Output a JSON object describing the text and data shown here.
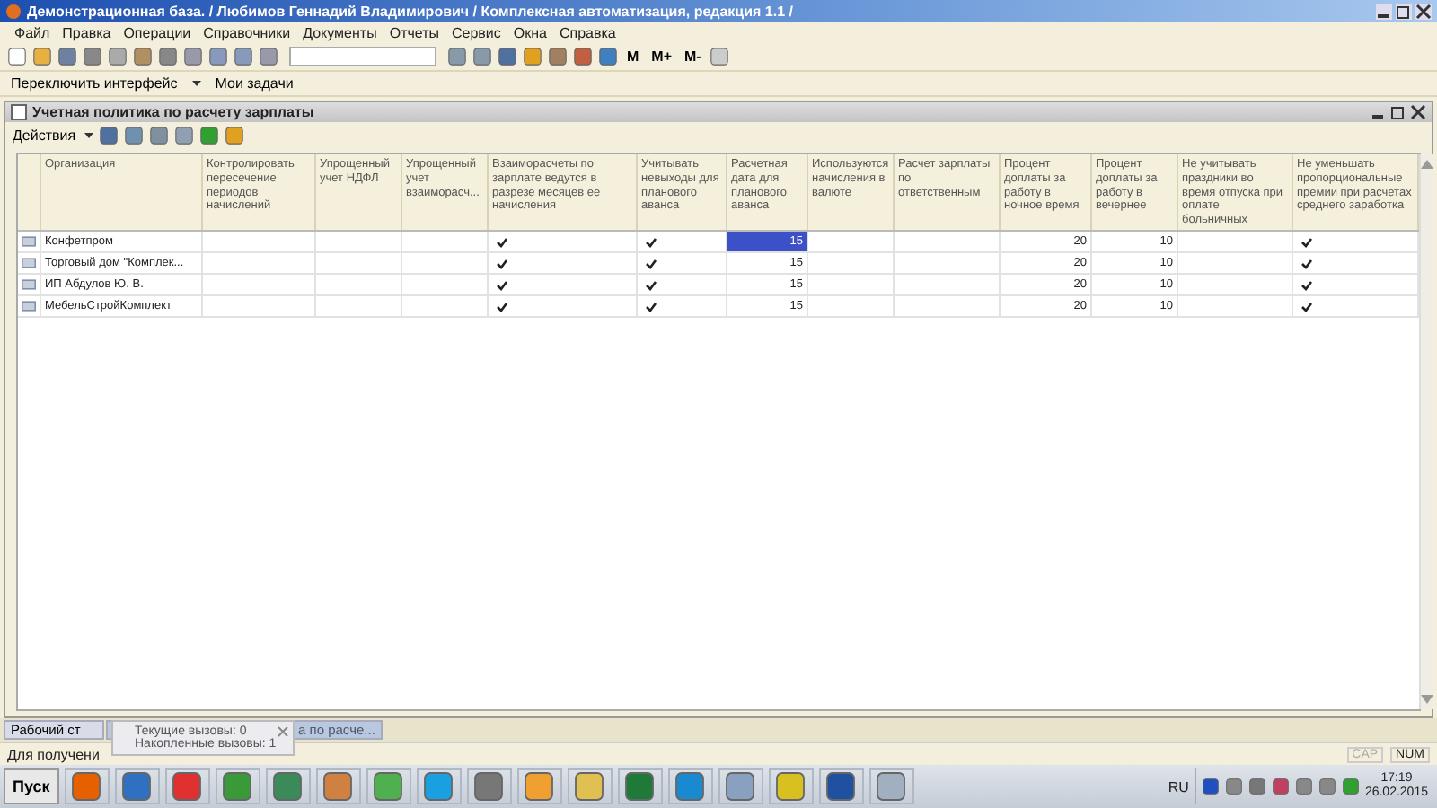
{
  "window": {
    "title": "Демонстрационная база. / Любимов Геннадий Владимирович / Комплексная автоматизация, редакция 1.1 /"
  },
  "menu": [
    "Файл",
    "Правка",
    "Операции",
    "Справочники",
    "Документы",
    "Отчеты",
    "Сервис",
    "Окна",
    "Справка"
  ],
  "toolbar": {
    "memory_buttons": [
      "M",
      "M+",
      "M-"
    ]
  },
  "panel_bar": {
    "switch_interface": "Переключить интерфейс",
    "my_tasks": "Мои задачи"
  },
  "document": {
    "title": "Учетная политика по расчету зарплаты",
    "actions": "Действия",
    "table": {
      "columns": [
        {
          "label": "Организация",
          "kind": "text"
        },
        {
          "label": "Контролировать пересечение периодов начислений",
          "kind": "check"
        },
        {
          "label": "Упрощенный учет НДФЛ",
          "kind": "check"
        },
        {
          "label": "Упрощенный учет взаиморасч...",
          "kind": "check"
        },
        {
          "label": "Взаиморасчеты по зарплате ведутся в разрезе месяцев ее начисления",
          "kind": "check"
        },
        {
          "label": "Учитывать невыходы для планового аванса",
          "kind": "check"
        },
        {
          "label": "Расчетная дата для планового аванса",
          "kind": "number"
        },
        {
          "label": "Используются начисления в валюте",
          "kind": "check"
        },
        {
          "label": "Расчет зарплаты по ответственным",
          "kind": "check"
        },
        {
          "label": "Процент доплаты за работу в ночное время",
          "kind": "number"
        },
        {
          "label": "Процент доплаты за работу в вечернее",
          "kind": "number"
        },
        {
          "label": "Не учитывать праздники во время отпуска при оплате больничных",
          "kind": "check"
        },
        {
          "label": "Не уменьшать пропорциональные премии при расчетах среднего заработка",
          "kind": "check"
        }
      ],
      "rows": [
        {
          "cells": [
            {
              "value": "Конфетпром",
              "selected": false
            },
            {
              "checked": false,
              "selected": false
            },
            {
              "checked": false,
              "selected": false
            },
            {
              "checked": false,
              "selected": false
            },
            {
              "checked": true,
              "selected": false
            },
            {
              "checked": true,
              "selected": false
            },
            {
              "value": "15",
              "selected": true
            },
            {
              "checked": false,
              "selected": false
            },
            {
              "checked": false,
              "selected": false
            },
            {
              "value": "20",
              "selected": false
            },
            {
              "value": "10",
              "selected": false
            },
            {
              "checked": false,
              "selected": false
            },
            {
              "checked": true,
              "selected": false
            }
          ]
        },
        {
          "cells": [
            {
              "value": "Торговый дом \"Комплек...",
              "selected": false
            },
            {
              "checked": false,
              "selected": false
            },
            {
              "checked": false,
              "selected": false
            },
            {
              "checked": false,
              "selected": false
            },
            {
              "checked": true,
              "selected": false
            },
            {
              "checked": true,
              "selected": false
            },
            {
              "value": "15",
              "selected": false
            },
            {
              "checked": false,
              "selected": false
            },
            {
              "checked": false,
              "selected": false
            },
            {
              "value": "20",
              "selected": false
            },
            {
              "value": "10",
              "selected": false
            },
            {
              "checked": false,
              "selected": false
            },
            {
              "checked": true,
              "selected": false
            }
          ]
        },
        {
          "cells": [
            {
              "value": "ИП Абдулов Ю. В.",
              "selected": false
            },
            {
              "checked": false,
              "selected": false
            },
            {
              "checked": false,
              "selected": false
            },
            {
              "checked": false,
              "selected": false
            },
            {
              "checked": true,
              "selected": false
            },
            {
              "checked": true,
              "selected": false
            },
            {
              "value": "15",
              "selected": false
            },
            {
              "checked": false,
              "selected": false
            },
            {
              "checked": false,
              "selected": false
            },
            {
              "value": "20",
              "selected": false
            },
            {
              "value": "10",
              "selected": false
            },
            {
              "checked": false,
              "selected": false
            },
            {
              "checked": true,
              "selected": false
            }
          ]
        },
        {
          "cells": [
            {
              "value": "МебельСтройКомплект",
              "selected": false
            },
            {
              "checked": false,
              "selected": false
            },
            {
              "checked": false,
              "selected": false
            },
            {
              "checked": false,
              "selected": false
            },
            {
              "checked": true,
              "selected": false
            },
            {
              "checked": true,
              "selected": false
            },
            {
              "value": "15",
              "selected": false
            },
            {
              "checked": false,
              "selected": false
            },
            {
              "checked": false,
              "selected": false
            },
            {
              "value": "20",
              "selected": false
            },
            {
              "value": "10",
              "selected": false
            },
            {
              "checked": false,
              "selected": false
            },
            {
              "checked": true,
              "selected": false
            }
          ]
        }
      ]
    }
  },
  "window_tabs": [
    {
      "label": "Рабочий ст",
      "selected": false
    },
    {
      "label": "а по расче...",
      "selected": true
    }
  ],
  "notification": {
    "lines": [
      "Текущие вызовы: 0",
      "Накопленные вызовы: 1"
    ]
  },
  "status_bar": {
    "text": "Для получени",
    "indicators": [
      {
        "label": "CAP",
        "on": false
      },
      {
        "label": "NUM",
        "on": true
      }
    ]
  },
  "taskbar": {
    "start": "Пуск",
    "language": "RU",
    "time": "17:19",
    "date": "26.02.2015"
  }
}
